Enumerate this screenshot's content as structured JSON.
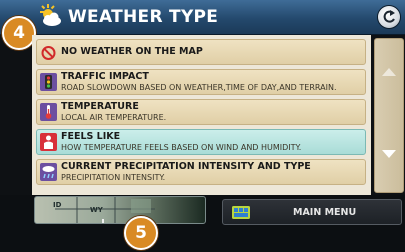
{
  "header": {
    "title": "WEATHER TYPE"
  },
  "steps": {
    "top": "4",
    "bottom": "5"
  },
  "list": {
    "items": [
      {
        "title": "NO WEATHER ON THE MAP",
        "subtitle": "",
        "icon": "no-weather-icon",
        "selected": false
      },
      {
        "title": "TRAFFIC IMPACT",
        "subtitle": "ROAD SLOWDOWN BASED ON WEATHER,TIME OF DAY,AND TERRAIN.",
        "icon": "traffic-light-icon",
        "selected": false
      },
      {
        "title": "TEMPERATURE",
        "subtitle": "LOCAL AIR TEMPERATURE.",
        "icon": "thermometer-icon",
        "selected": false
      },
      {
        "title": "FEELS LIKE",
        "subtitle": "HOW TEMPERATURE FEELS BASED ON WIND AND HUMIDITY.",
        "icon": "person-icon",
        "selected": true
      },
      {
        "title": "CURRENT PRECIPITATION INTENSITY AND TYPE",
        "subtitle": "PRECIPITATION INTENSITY.",
        "icon": "precipitation-icon",
        "selected": false
      }
    ]
  },
  "map_preview": {
    "labels": [
      "ID",
      "WY"
    ]
  },
  "bottom": {
    "main_menu_label": "MAIN MENU"
  },
  "colors": {
    "header": "#2a5075",
    "item": "#e8d9b6",
    "selected": "#b8e4df",
    "badge": "#d98a24"
  }
}
